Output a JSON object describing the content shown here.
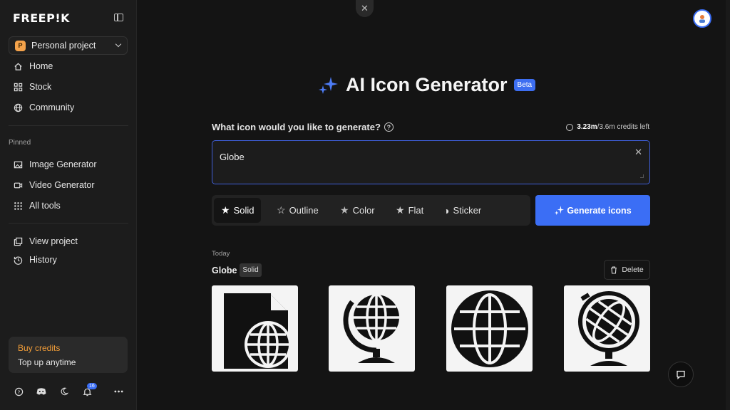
{
  "sidebar": {
    "logo": "FREEP!K",
    "project": {
      "badge": "P",
      "name": "Personal project"
    },
    "nav": [
      {
        "label": "Home",
        "icon": "home-icon"
      },
      {
        "label": "Stock",
        "icon": "grid-icon"
      },
      {
        "label": "Community",
        "icon": "globe-icon"
      }
    ],
    "pinned_label": "Pinned",
    "pinned": [
      {
        "label": "Image Generator",
        "icon": "image-icon"
      },
      {
        "label": "Video Generator",
        "icon": "video-icon"
      },
      {
        "label": "All tools",
        "icon": "dots-grid-icon"
      }
    ],
    "project_links": [
      {
        "label": "View project",
        "icon": "copy-icon"
      },
      {
        "label": "History",
        "icon": "history-icon"
      }
    ],
    "credits": {
      "title": "Buy credits",
      "subtitle": "Top up anytime"
    },
    "notifications_count": "16"
  },
  "main": {
    "title": "AI Icon Generator",
    "beta": "Beta",
    "question": "What icon would you like to generate?",
    "credits_used": "3.23m",
    "credits_total": "/3.6m credits left",
    "prompt_value": "Globe",
    "styles": [
      {
        "label": "Solid",
        "icon": "★",
        "active": true
      },
      {
        "label": "Outline",
        "icon": "☆",
        "active": false
      },
      {
        "label": "Color",
        "icon": "★",
        "active": false
      },
      {
        "label": "Flat",
        "icon": "★",
        "active": false
      },
      {
        "label": "Sticker",
        "icon": "◑",
        "active": false
      }
    ],
    "generate_label": "Generate icons",
    "results": {
      "date": "Today",
      "title": "Globe",
      "style_tag": "Solid",
      "delete_label": "Delete"
    }
  },
  "colors": {
    "accent": "#3b6ef5",
    "credits": "#f29d38",
    "background": "#141414"
  }
}
